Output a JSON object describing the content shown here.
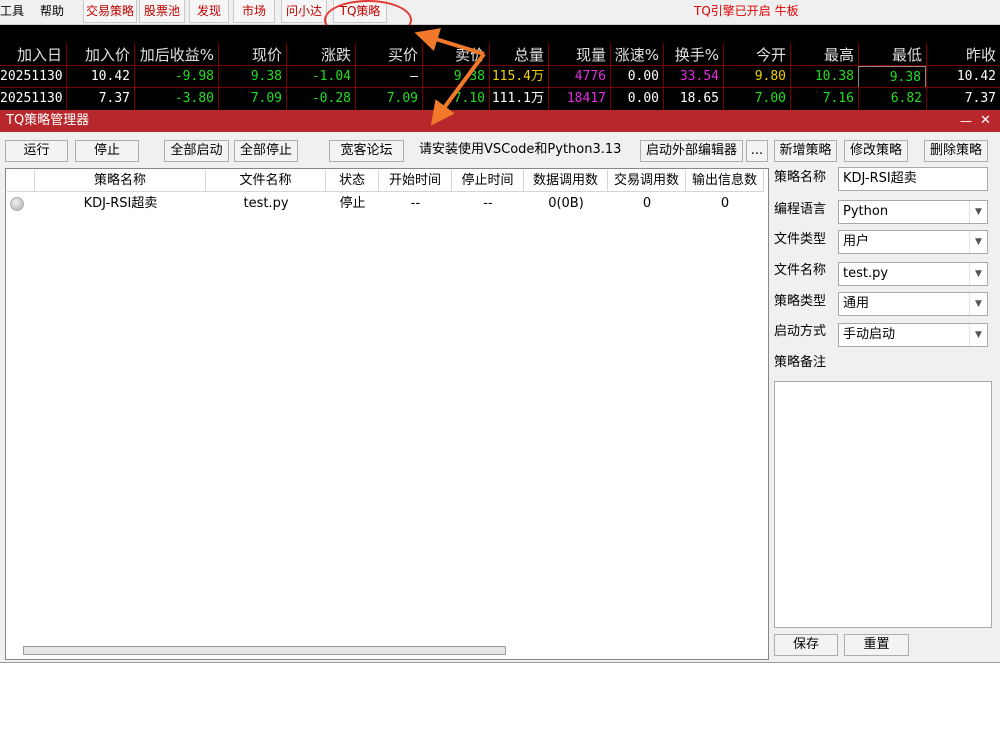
{
  "menubar": {
    "items": [
      "工具",
      "帮助"
    ],
    "tabs": [
      "交易策略",
      "股票池",
      "发现",
      "市场",
      "问小达",
      "TQ策略"
    ],
    "status": "TQ引擎已开启  牛板"
  },
  "quote_table": {
    "headers": [
      "加入日",
      "加入价",
      "加后收益%",
      "现价",
      "涨跌",
      "买价",
      "卖价",
      "总量",
      "现量",
      "涨速%",
      "换手%",
      "今开",
      "最高",
      "最低",
      "昨收"
    ],
    "rows": [
      [
        "20251130",
        "10.42",
        "-9.98",
        "9.38",
        "-1.04",
        "–",
        "9.38",
        "115.4万",
        "4776",
        "0.00",
        "33.54",
        "9.80",
        "10.38",
        "9.38",
        "10.42"
      ],
      [
        "20251130",
        "7.37",
        "-3.80",
        "7.09",
        "-0.28",
        "7.09",
        "7.10",
        "111.1万",
        "18417",
        "0.00",
        "18.65",
        "7.00",
        "7.16",
        "6.82",
        "7.37"
      ]
    ],
    "colors": {
      "header": "#e0e0e0",
      "white": "#ffffff",
      "green": "#22dd22",
      "yellow": "#f0d000",
      "magenta": "#e030e0",
      "border": "#7a0000"
    }
  },
  "dialog": {
    "title": "TQ策略管理器",
    "minimize": "—",
    "close": "✕",
    "toolbar": {
      "run": "运行",
      "stop": "停止",
      "start_all": "全部启动",
      "stop_all": "全部停止",
      "forum": "宽客论坛",
      "hint": "请安装使用VSCode和Python3.13",
      "launch_editor": "启动外部编辑器",
      "more": "...",
      "add": "新增策略",
      "edit": "修改策略",
      "delete": "删除策略"
    },
    "grid": {
      "columns": [
        "策略名称",
        "文件名称",
        "状态",
        "开始时间",
        "停止时间",
        "数据调用数",
        "交易调用数",
        "输出信息数"
      ],
      "rows": [
        {
          "name": "KDJ-RSI超卖",
          "file": "test.py",
          "status": "停止",
          "start": "--",
          "stop": "--",
          "data_calls": "0(0B)",
          "trade_calls": "0",
          "output_count": "0"
        }
      ]
    },
    "form": {
      "name_label": "策略名称",
      "name_value": "KDJ-RSI超卖",
      "lang_label": "编程语言",
      "lang_value": "Python",
      "filetype_label": "文件类型",
      "filetype_value": "用户",
      "filename_label": "文件名称",
      "filename_value": "test.py",
      "type_label": "策略类型",
      "type_value": "通用",
      "start_label": "启动方式",
      "start_value": "手动启动",
      "remark_label": "策略备注",
      "save": "保存",
      "reset": "重置"
    }
  },
  "annotation_colors": {
    "circle": "#e53935",
    "arrow": "#f07a2a"
  }
}
